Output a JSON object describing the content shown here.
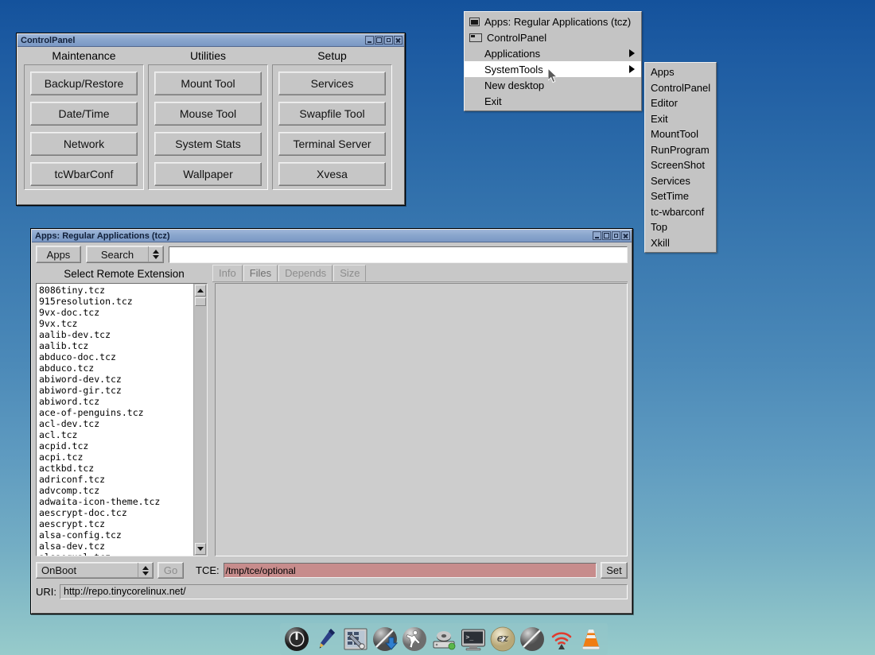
{
  "desktop": {
    "background_top": "#14529c",
    "background_bottom": "#97cbcb"
  },
  "control_panel": {
    "title": "ControlPanel",
    "columns": [
      {
        "heading": "Maintenance",
        "buttons": [
          "Backup/Restore",
          "Date/Time",
          "Network",
          "tcWbarConf"
        ]
      },
      {
        "heading": "Utilities",
        "buttons": [
          "Mount Tool",
          "Mouse Tool",
          "System Stats",
          "Wallpaper"
        ]
      },
      {
        "heading": "Setup",
        "buttons": [
          "Services",
          "Swapfile Tool",
          "Terminal Server",
          "Xvesa"
        ]
      }
    ],
    "titlebar_buttons": [
      "minimize",
      "maximize",
      "restore",
      "close"
    ]
  },
  "apps_window": {
    "title": "Apps: Regular Applications (tcz)",
    "toolbar": {
      "apps_button": "Apps",
      "mode_select": "Search",
      "search_value": "",
      "search_placeholder": ""
    },
    "list_heading": "Select Remote Extension",
    "tabs": [
      {
        "label": "Info",
        "active": false,
        "enabled": false
      },
      {
        "label": "Files",
        "active": true,
        "enabled": false
      },
      {
        "label": "Depends",
        "active": false,
        "enabled": false
      },
      {
        "label": "Size",
        "active": false,
        "enabled": false
      }
    ],
    "extensions": [
      "8086tiny.tcz",
      "915resolution.tcz",
      "9vx-doc.tcz",
      "9vx.tcz",
      "aalib-dev.tcz",
      "aalib.tcz",
      "abduco-doc.tcz",
      "abduco.tcz",
      "abiword-dev.tcz",
      "abiword-gir.tcz",
      "abiword.tcz",
      "ace-of-penguins.tcz",
      "acl-dev.tcz",
      "acl.tcz",
      "acpid.tcz",
      "acpi.tcz",
      "actkbd.tcz",
      "adriconf.tcz",
      "advcomp.tcz",
      "adwaita-icon-theme.tcz",
      "aescrypt-doc.tcz",
      "aescrypt.tcz",
      "alsa-config.tcz",
      "alsa-dev.tcz",
      "alsaequal.tcz"
    ],
    "info_panel_text": "",
    "bottom": {
      "mode_select": "OnBoot",
      "go_button": "Go",
      "tce_label": "TCE:",
      "tce_path": "/tmp/tce/optional",
      "tce_field_color": "#c78c8c",
      "set_button": "Set",
      "uri_label": "URI:",
      "uri_value": "http://repo.tinycorelinux.net/"
    },
    "titlebar_buttons": [
      "minimize",
      "maximize",
      "restore",
      "close"
    ]
  },
  "root_menu": {
    "items": [
      {
        "label": "Apps: Regular Applications (tcz)",
        "icon": "window-icon-active",
        "submenu": false,
        "selected": false
      },
      {
        "label": "ControlPanel",
        "icon": "window-icon-inactive",
        "submenu": false,
        "selected": false
      },
      {
        "label": "Applications",
        "icon": "",
        "submenu": true,
        "selected": false
      },
      {
        "label": "SystemTools",
        "icon": "",
        "submenu": true,
        "selected": true
      },
      {
        "label": "New desktop",
        "icon": "",
        "submenu": false,
        "selected": false
      },
      {
        "label": "Exit",
        "icon": "",
        "submenu": false,
        "selected": false
      }
    ]
  },
  "system_tools_submenu": {
    "items": [
      "Apps",
      "ControlPanel",
      "Editor",
      "Exit",
      "MountTool",
      "RunProgram",
      "ScreenShot",
      "Services",
      "SetTime",
      "tc-wbarconf",
      "Top",
      "Xkill"
    ]
  },
  "wbar": {
    "icons": [
      {
        "name": "power-icon",
        "tooltip": "Power"
      },
      {
        "name": "pen-icon",
        "tooltip": "Editor"
      },
      {
        "name": "control-panel-icon",
        "tooltip": "ControlPanel"
      },
      {
        "name": "apps-download-icon",
        "tooltip": "Apps"
      },
      {
        "name": "runprogram-icon",
        "tooltip": "RunProgram"
      },
      {
        "name": "mount-tool-icon",
        "tooltip": "MountTool"
      },
      {
        "name": "terminal-icon",
        "tooltip": "Terminal"
      },
      {
        "name": "ezremaster-icon",
        "tooltip": "ezremaster"
      },
      {
        "name": "disc-icon",
        "tooltip": "Disc"
      },
      {
        "name": "wifi-icon",
        "tooltip": "Wireless"
      },
      {
        "name": "vlc-cone-icon",
        "tooltip": "VLC"
      }
    ]
  }
}
